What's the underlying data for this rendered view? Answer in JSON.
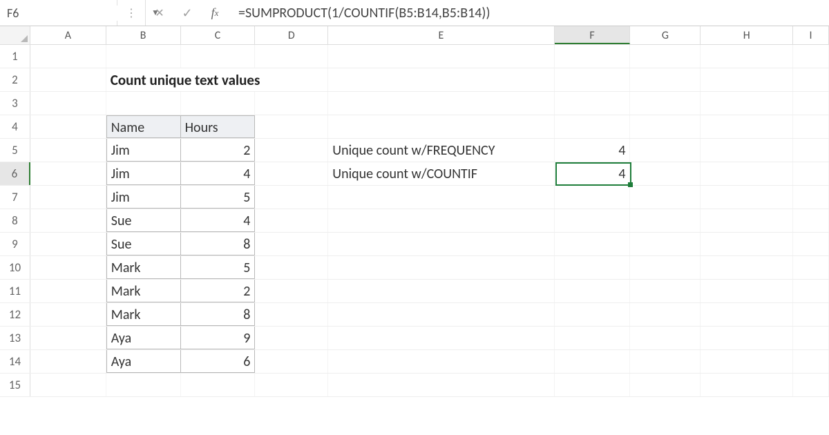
{
  "namebox": {
    "value": "F6"
  },
  "formula": "=SUMPRODUCT(1/COUNTIF(B5:B14,B5:B14))",
  "columns": [
    "A",
    "B",
    "C",
    "D",
    "E",
    "F",
    "G",
    "H",
    "I"
  ],
  "active_col": "F",
  "active_row": 6,
  "title": "Count unique text values",
  "table": {
    "headers": {
      "name": "Name",
      "hours": "Hours"
    },
    "rows": [
      {
        "name": "Jim",
        "hours": 2
      },
      {
        "name": "Jim",
        "hours": 4
      },
      {
        "name": "Jim",
        "hours": 5
      },
      {
        "name": "Sue",
        "hours": 4
      },
      {
        "name": "Sue",
        "hours": 8
      },
      {
        "name": "Mark",
        "hours": 5
      },
      {
        "name": "Mark",
        "hours": 2
      },
      {
        "name": "Mark",
        "hours": 8
      },
      {
        "name": "Aya",
        "hours": 9
      },
      {
        "name": "Aya",
        "hours": 6
      }
    ]
  },
  "results": {
    "freq_label": "Unique count w/FREQUENCY",
    "freq_value": 4,
    "countif_label": "Unique count w/COUNTIF",
    "countif_value": 4
  },
  "chart_data": {
    "type": "table",
    "columns": [
      "Name",
      "Hours"
    ],
    "rows": [
      [
        "Jim",
        2
      ],
      [
        "Jim",
        4
      ],
      [
        "Jim",
        5
      ],
      [
        "Sue",
        4
      ],
      [
        "Sue",
        8
      ],
      [
        "Mark",
        5
      ],
      [
        "Mark",
        2
      ],
      [
        "Mark",
        8
      ],
      [
        "Aya",
        9
      ],
      [
        "Aya",
        6
      ]
    ],
    "derived": {
      "unique_name_count": 4
    }
  }
}
